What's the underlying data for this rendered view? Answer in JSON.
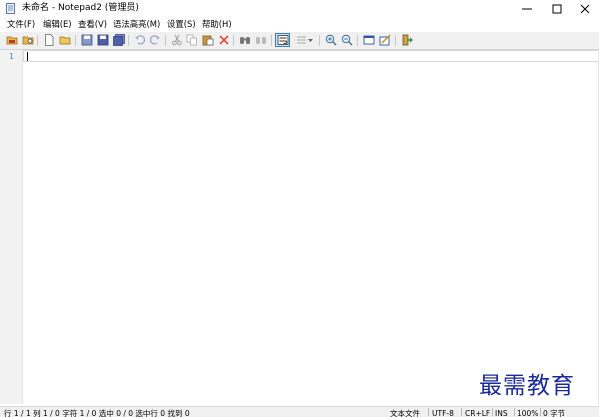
{
  "window": {
    "title": "未命名 - Notepad2 (管理员)",
    "app_icon": "notepad-icon",
    "controls": [
      "minimize-icon",
      "maximize-icon",
      "close-icon"
    ]
  },
  "menubar": {
    "items": [
      {
        "label": "文件(F)"
      },
      {
        "label": "编辑(E)"
      },
      {
        "label": "查看(V)"
      },
      {
        "label": "语法高亮(M)"
      },
      {
        "label": "设置(S)"
      },
      {
        "label": "帮助(H)"
      }
    ]
  },
  "toolbar": {
    "buttons": [
      "open-folder-icon",
      "browse-icon",
      "new-file-icon",
      "open-file-icon",
      "save-icon",
      "save-as-icon",
      "save-copy-icon",
      "undo-icon",
      "redo-icon",
      "cut-icon",
      "copy-icon",
      "paste-icon",
      "delete-icon",
      "find-icon",
      "replace-icon",
      "word-wrap-icon",
      "bookmark-icon",
      "zoom-in-icon",
      "zoom-out-icon",
      "scheme-icon",
      "customize-schemes-icon",
      "exit-icon"
    ],
    "active_button": "word-wrap-icon"
  },
  "editor": {
    "line_numbers": [
      "1"
    ],
    "content": ""
  },
  "statusbar": {
    "position": "行 1 / 1   列 1 / 0   字符 1 / 0   选中 0 / 0   选中行 0   找到 0",
    "size": "0 字节",
    "encoding": "UTF-8",
    "eol": "CR+LF",
    "mode": "INS",
    "zoom": "100%",
    "scheme": "文本文件"
  },
  "watermark": {
    "text": "最需教育"
  },
  "colors": {
    "toolbar_bg": "#f0f0f0",
    "gutter_bg": "#f2f2f2",
    "line_number": "#2b91af",
    "watermark": "#1a2a9a",
    "active_button_bg": "#cce4f7"
  }
}
